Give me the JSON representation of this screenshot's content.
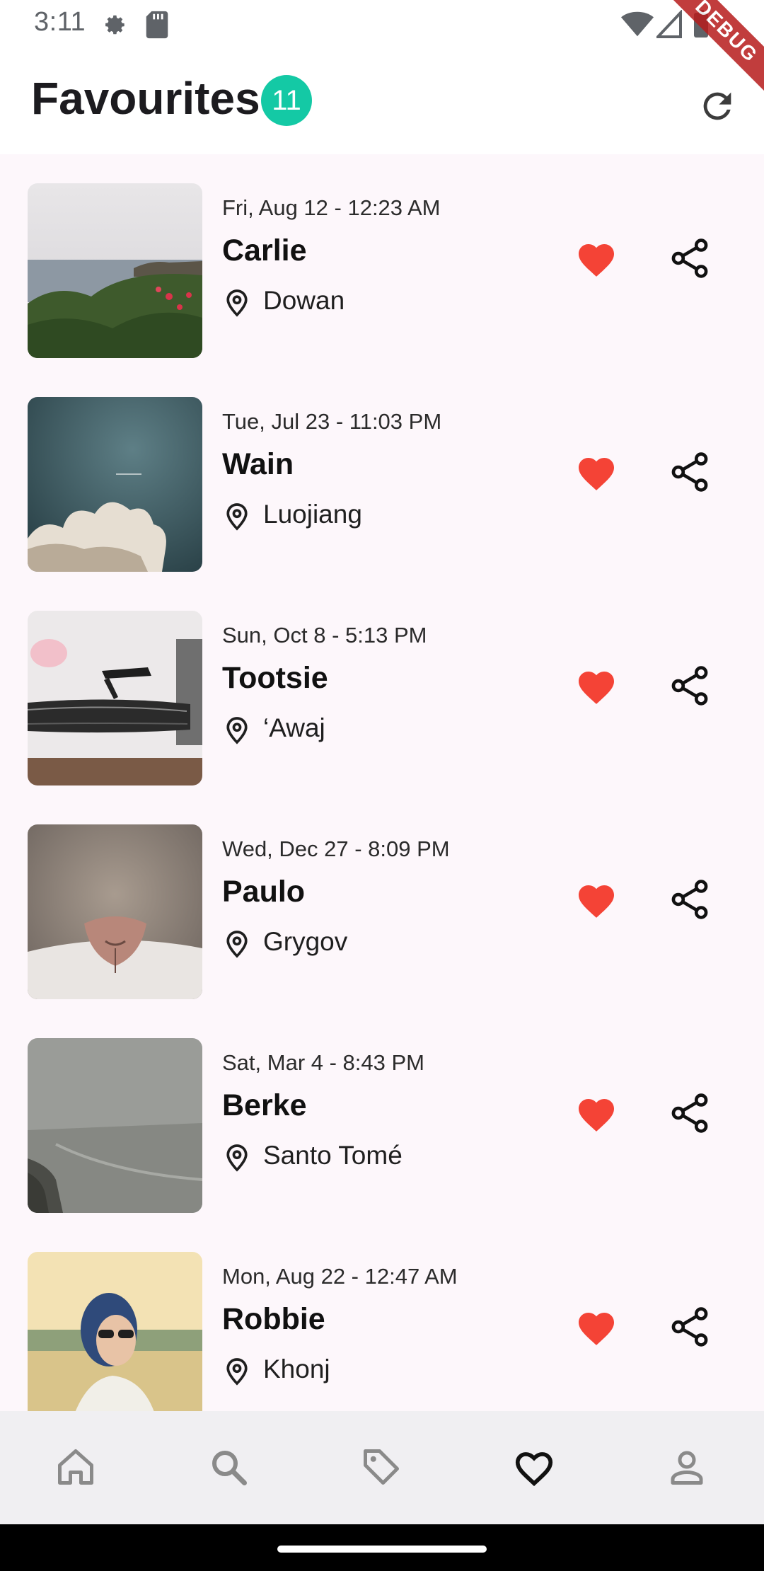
{
  "status_bar": {
    "time": "3:11",
    "icons": [
      "settings-gear-icon",
      "sd-card-icon",
      "wifi-icon",
      "signal-icon",
      "battery-icon"
    ],
    "debug_label": "DEBUG"
  },
  "header": {
    "title": "Favourites",
    "count": "11",
    "badge_color": "#14c9a5",
    "refresh_icon": "refresh-icon"
  },
  "colors": {
    "heart": "#f44336",
    "list_background": "#fdf7fb"
  },
  "items": [
    {
      "date": "Fri, Aug 12 - 12:23 AM",
      "name": "Carlie",
      "location": "Dowan",
      "image": "coastline-photo",
      "favourite": true
    },
    {
      "date": "Tue, Jul 23 - 11:03 PM",
      "name": "Wain",
      "location": "Luojiang",
      "image": "cloud-sky-photo",
      "favourite": true
    },
    {
      "date": "Sun, Oct 8 - 5:13 PM",
      "name": "Tootsie",
      "location": "‘Awaj",
      "image": "record-player-photo",
      "favourite": true
    },
    {
      "date": "Wed, Dec 27 - 8:09 PM",
      "name": "Paulo",
      "location": "Grygov",
      "image": "cat-nose-photo",
      "favourite": true
    },
    {
      "date": "Sat, Mar 4 - 8:43 PM",
      "name": "Berke",
      "location": "Santo Tomé",
      "image": "foggy-beach-photo",
      "favourite": true
    },
    {
      "date": "Mon, Aug 22 - 12:47 AM",
      "name": "Robbie",
      "location": "Khonj",
      "image": "woman-sunglasses-photo",
      "favourite": true
    }
  ],
  "bottom_nav": {
    "items": [
      {
        "icon": "home-icon",
        "active": false
      },
      {
        "icon": "search-icon",
        "active": false
      },
      {
        "icon": "tag-icon",
        "active": false
      },
      {
        "icon": "heart-outline-icon",
        "active": true
      },
      {
        "icon": "person-icon",
        "active": false
      }
    ]
  }
}
